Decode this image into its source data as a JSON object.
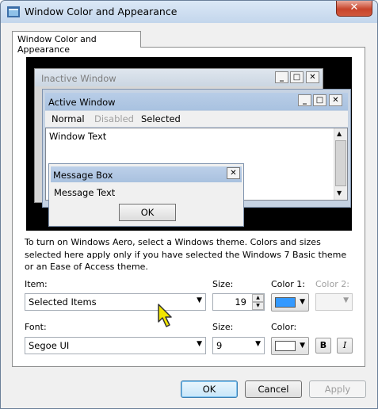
{
  "window": {
    "title": "Window Color and Appearance"
  },
  "tab": {
    "label": "Window Color and Appearance"
  },
  "preview": {
    "inactive_title": "Inactive Window",
    "active_title": "Active Window",
    "menu": {
      "normal": "Normal",
      "disabled": "Disabled",
      "selected": "Selected"
    },
    "window_text": "Window Text",
    "message_box_title": "Message Box",
    "message_text": "Message Text",
    "ok": "OK"
  },
  "description": "To turn on Windows Aero, select a Windows theme.  Colors and sizes selected here apply only if you have selected the Windows 7 Basic theme or an Ease of Access theme.",
  "item": {
    "label": "Item:",
    "value": "Selected Items"
  },
  "size1": {
    "label": "Size:",
    "value": "19"
  },
  "color1": {
    "label": "Color 1:",
    "swatch": "#3399ff"
  },
  "color2": {
    "label": "Color 2:"
  },
  "font": {
    "label": "Font:",
    "value": "Segoe UI"
  },
  "size2": {
    "label": "Size:",
    "value": "9"
  },
  "color": {
    "label": "Color:",
    "swatch": "#ffffff"
  },
  "format": {
    "bold": "B",
    "italic": "I"
  },
  "buttons": {
    "ok": "OK",
    "cancel": "Cancel",
    "apply": "Apply"
  }
}
